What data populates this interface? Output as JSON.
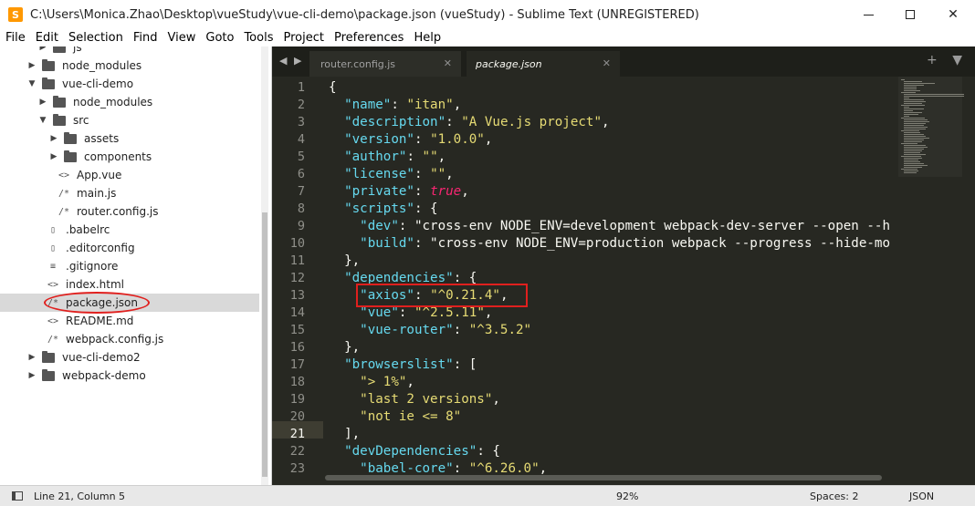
{
  "window": {
    "title": "C:\\Users\\Monica.Zhao\\Desktop\\vueStudy\\vue-cli-demo\\package.json (vueStudy) - Sublime Text (UNREGISTERED)",
    "app_icon": "S"
  },
  "menu": [
    "File",
    "Edit",
    "Selection",
    "Find",
    "View",
    "Goto",
    "Tools",
    "Project",
    "Preferences",
    "Help"
  ],
  "sidebar": {
    "items": [
      {
        "label": "js",
        "kind": "folder",
        "depth": 1,
        "expanded": false
      },
      {
        "label": "node_modules",
        "kind": "folder",
        "depth": 0,
        "expanded": false
      },
      {
        "label": "vue-cli-demo",
        "kind": "folder",
        "depth": 0,
        "expanded": true
      },
      {
        "label": "node_modules",
        "kind": "folder",
        "depth": 1,
        "expanded": false
      },
      {
        "label": "src",
        "kind": "folder",
        "depth": 1,
        "expanded": true
      },
      {
        "label": "assets",
        "kind": "folder",
        "depth": 2,
        "expanded": false
      },
      {
        "label": "components",
        "kind": "folder",
        "depth": 2,
        "expanded": false
      },
      {
        "label": "App.vue",
        "kind": "file",
        "icon": "<>",
        "depth": 2
      },
      {
        "label": "main.js",
        "kind": "file",
        "icon": "/*",
        "depth": 2
      },
      {
        "label": "router.config.js",
        "kind": "file",
        "icon": "/*",
        "depth": 2
      },
      {
        "label": ".babelrc",
        "kind": "file",
        "icon": "doc",
        "depth": 1
      },
      {
        "label": ".editorconfig",
        "kind": "file",
        "icon": "doc",
        "depth": 1
      },
      {
        "label": ".gitignore",
        "kind": "file",
        "icon": "lines",
        "depth": 1
      },
      {
        "label": "index.html",
        "kind": "file",
        "icon": "<>",
        "depth": 1
      },
      {
        "label": "package.json",
        "kind": "file",
        "icon": "/*",
        "depth": 1,
        "selected": true
      },
      {
        "label": "README.md",
        "kind": "file",
        "icon": "<>",
        "depth": 1
      },
      {
        "label": "webpack.config.js",
        "kind": "file",
        "icon": "/*",
        "depth": 1
      },
      {
        "label": "vue-cli-demo2",
        "kind": "folder",
        "depth": 0,
        "expanded": false
      },
      {
        "label": "webpack-demo",
        "kind": "folder",
        "depth": 0,
        "expanded": false
      }
    ]
  },
  "tabs": [
    {
      "label": "router.config.js",
      "active": false
    },
    {
      "label": "package.json",
      "active": true
    }
  ],
  "tab_nav": "◀ ▶",
  "tab_tools": "+ ▼",
  "editor": {
    "current_line": 21,
    "line_numbers": [
      "1",
      "2",
      "3",
      "4",
      "5",
      "6",
      "7",
      "8",
      "9",
      "10",
      "11",
      "12",
      "13",
      "14",
      "15",
      "16",
      "17",
      "18",
      "19",
      "20",
      "21",
      "22",
      "23"
    ],
    "lines": [
      "{",
      "  \"name\": \"itan\",",
      "  \"description\": \"A Vue.js project\",",
      "  \"version\": \"1.0.0\",",
      "  \"author\": \"\",",
      "  \"license\": \"\",",
      "  \"private\": true,",
      "  \"scripts\": {",
      "    \"dev\": \"cross-env NODE_ENV=development webpack-dev-server --open --h",
      "    \"build\": \"cross-env NODE_ENV=production webpack --progress --hide-mo",
      "  },",
      "  \"dependencies\": {",
      "    \"axios\": \"^0.21.4\",",
      "    \"vue\": \"^2.5.11\",",
      "    \"vue-router\": \"^3.5.2\"",
      "  },",
      "  \"browserslist\": [",
      "    \"> 1%\",",
      "    \"last 2 versions\",",
      "    \"not ie <= 8\"",
      "  ],",
      "  \"devDependencies\": {",
      "    \"babel-core\": \"^6.26.0\","
    ]
  },
  "status": {
    "position": "Line 21, Column 5",
    "zoom": "92%",
    "spaces": "Spaces: 2",
    "syntax": "JSON"
  },
  "colors": {
    "editor_bg": "#272822",
    "key": "#66d9ef",
    "string": "#e6db74",
    "boolean": "#f92672",
    "annotation": "#e0201e"
  }
}
